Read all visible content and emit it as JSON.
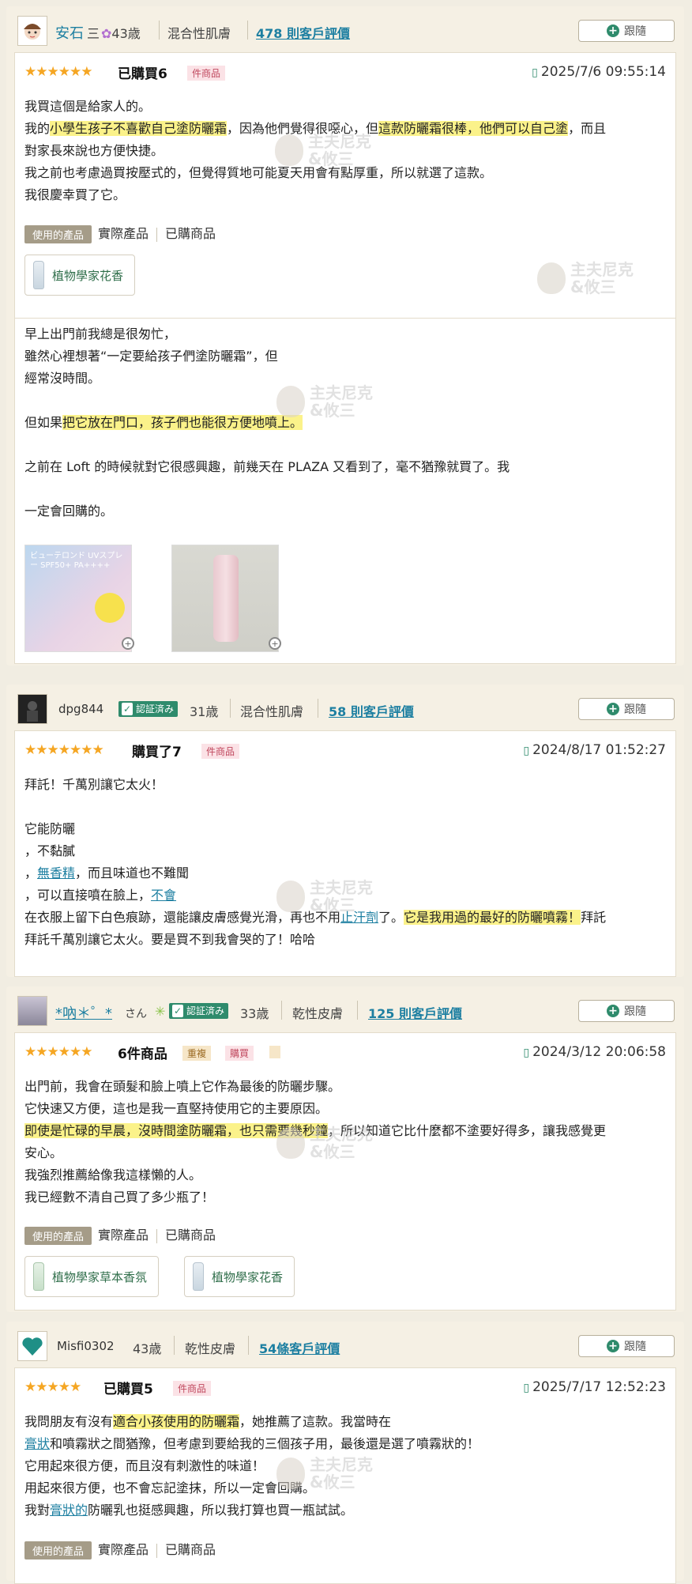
{
  "reviews": [
    {
      "username": "安石",
      "suffix": "三",
      "age": "43歳",
      "skin": "混合性肌膚",
      "review_count": "478 則客戶評價",
      "follow_label": "跟隨",
      "purchase": "已購買6",
      "tag": "件商品",
      "datetime": "2025/7/6 09:55:14",
      "lines": [
        "我買這個是給家人的。",
        "我的小學生孩子不喜歡自己塗防曬霜，因為他們覺得很噁心，但這款防曬霜很棒，他們可以自己塗，而且",
        "對家長來說也方便快捷。",
        "我之前也考慮過買按壓式的，但覺得質地可能夏天用會有點厚重，所以就選了這款。",
        "我很慶幸買了它。"
      ],
      "product_label": "使用的產品",
      "product_type": "實際產品",
      "purchased_label": "已購商品",
      "chips": [
        "植物學家花香"
      ]
    },
    {
      "lines": [
        "早上出門前我總是很匆忙，",
        "雖然心裡想著“一定要給孩子們塗防曬霜”，但",
        "經常沒時間。",
        "",
        "但如果把它放在門口，孩子們也能很方便地噴上。",
        "",
        "之前在 Loft 的時候就對它很感興趣，前幾天在 PLAZA 又看到了，毫不猶豫就買了。我",
        "",
        "一定會回購的。"
      ],
      "photo1_text": "ビューテロンド UVスプレー SPF50+ PA++++"
    },
    {
      "username": "dpg844",
      "verified": "認証済み",
      "age": "31歳",
      "skin": "混合性肌膚",
      "review_count": "58 則客戶評價",
      "follow_label": "跟隨",
      "purchase": "購買了7",
      "tag": "件商品",
      "datetime": "2024/8/17 01:52:27",
      "lines": [
        "拜託！千萬別讓它太火！",
        "",
        "它能防曬",
        "，不黏膩",
        "，無香精，而且味道也不難聞",
        "，可以直接噴在臉上，不會",
        "在衣服上留下白色痕跡，還能讓皮膚感覺光滑，再也不用止汗劑了。它是我用過的最好的防曬噴霧！拜託",
        "拜託千萬別讓它太火。要是買不到我會哭的了！哈哈"
      ]
    },
    {
      "username": "*吶＊゜*",
      "suffix": "さん",
      "verified": "認証済み",
      "age": "33歳",
      "skin": "乾性皮膚",
      "review_count": "125 則客戶評價",
      "follow_label": "跟隨",
      "purchase": "6件商品",
      "tag1": "重複",
      "tag2": "購買",
      "datetime": "2024/3/12 20:06:58",
      "lines": [
        "出門前，我會在頭髮和臉上噴上它作為最後的防曬步驟。",
        "它快速又方便，這也是我一直堅持使用它的主要原因。",
        "即使是忙碌的早晨，沒時間塗防曬霜，也只需要幾秒鐘，所以知道它比什麼都不塗要好得多，讓我感覺更",
        "安心。",
        "我強烈推薦給像我這樣懶的人。",
        "我已經數不清自己買了多少瓶了！"
      ],
      "product_label": "使用的產品",
      "product_type": "實際產品",
      "purchased_label": "已購商品",
      "chips": [
        "植物學家草本香氛",
        "植物學家花香"
      ]
    },
    {
      "username": "Misfi0302",
      "age": "43歳",
      "skin": "乾性皮膚",
      "review_count": "54條客戶評價",
      "follow_label": "跟隨",
      "purchase": "已購買5",
      "tag": "件商品",
      "datetime": "2025/7/17 12:52:23",
      "lines": [
        "我問朋友有沒有適合小孩使用的防曬霜，她推薦了這款。我當時在",
        "膏狀和噴霧狀之間猶豫，但考慮到要給我的三個孩子用，最後還是選了噴霧狀的！",
        "它用起來很方便，而且沒有刺激性的味道！",
        "用起來很方便，也不會忘記塗抹，所以一定會回購。",
        "我對膏狀的防曬乳也挺感興趣，所以我打算也買一瓶試試。"
      ],
      "product_label": "使用的產品",
      "product_type": "實際產品",
      "purchased_label": "已購商品"
    }
  ],
  "watermark": "主夫尼克\n&攸三"
}
